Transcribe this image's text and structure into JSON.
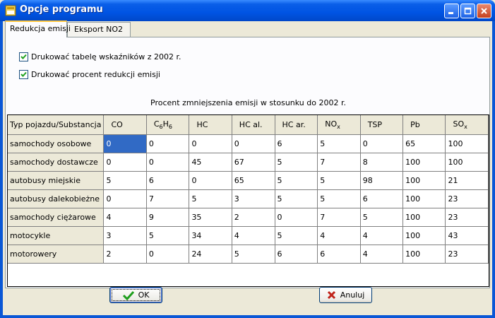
{
  "window": {
    "title": "Opcje programu"
  },
  "tabs": [
    {
      "label": "Redukcja emisji",
      "active": true
    },
    {
      "label": "Eksport NO2",
      "active": false
    }
  ],
  "options": [
    {
      "label": "Drukować tabelę wskaźników z 2002 r.",
      "checked": true
    },
    {
      "label": "Drukować procent redukcji emisji",
      "checked": true
    }
  ],
  "caption": "Procent zmniejszenia emisji w stosunku do 2002 r.",
  "grid": {
    "corner": "Typ pojazdu/Substancja",
    "columns": [
      {
        "main": "CO",
        "sub": ""
      },
      {
        "main": "C",
        "sub": "6",
        "main2": "H",
        "sub2": "6"
      },
      {
        "main": "HC",
        "sub": ""
      },
      {
        "main": "HC al.",
        "sub": ""
      },
      {
        "main": "HC ar.",
        "sub": ""
      },
      {
        "main": "NO",
        "sub": "x"
      },
      {
        "main": "TSP",
        "sub": ""
      },
      {
        "main": "Pb",
        "sub": ""
      },
      {
        "main": "SO",
        "sub": "x"
      }
    ],
    "rows": [
      {
        "label": "samochody osobowe",
        "values": [
          "0",
          "0",
          "0",
          "0",
          "6",
          "5",
          "0",
          "65",
          "100"
        ]
      },
      {
        "label": "samochody dostawcze",
        "values": [
          "0",
          "0",
          "45",
          "67",
          "5",
          "7",
          "8",
          "100",
          "100"
        ]
      },
      {
        "label": "autobusy miejskie",
        "values": [
          "5",
          "6",
          "0",
          "65",
          "5",
          "5",
          "98",
          "100",
          "21"
        ]
      },
      {
        "label": "autobusy dalekobieżne",
        "values": [
          "0",
          "7",
          "5",
          "3",
          "5",
          "5",
          "6",
          "100",
          "23"
        ]
      },
      {
        "label": "samochody ciężarowe",
        "values": [
          "4",
          "9",
          "35",
          "2",
          "0",
          "7",
          "5",
          "100",
          "23"
        ]
      },
      {
        "label": "motocykle",
        "values": [
          "3",
          "5",
          "34",
          "4",
          "5",
          "4",
          "4",
          "100",
          "43"
        ]
      },
      {
        "label": "motorowery",
        "values": [
          "2",
          "0",
          "24",
          "5",
          "6",
          "6",
          "4",
          "100",
          "23"
        ]
      }
    ]
  },
  "buttons": {
    "ok": "OK",
    "cancel": "Anuluj"
  },
  "colors": {
    "title_bar": "#0054E3",
    "selection": "#316AC5",
    "face": "#ECE9D8"
  }
}
